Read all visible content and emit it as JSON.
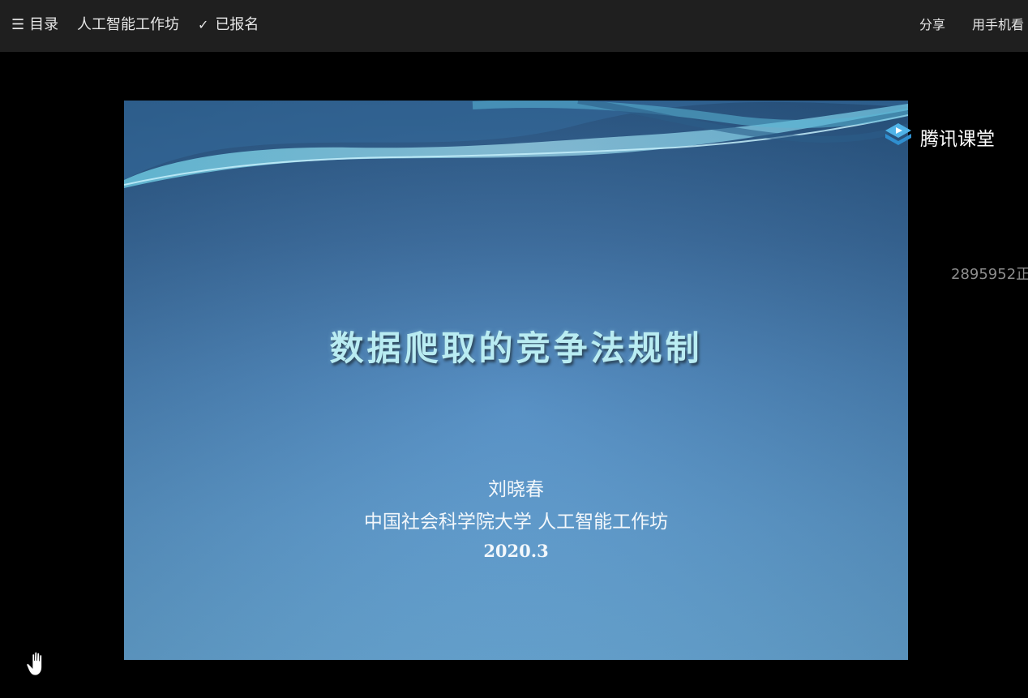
{
  "topbar": {
    "menu_icon_glyph": "☰",
    "menu_label": "目录",
    "course_title": "人工智能工作坊",
    "check_glyph": "✓",
    "registered_label": "已报名",
    "share_label": "分享",
    "mobile_label": "用手机看"
  },
  "slide": {
    "title": "数据爬取的竞争法规制",
    "author": "刘晓春",
    "affiliation": "中国社会科学院大学  人工智能工作坊",
    "date": "2020.3"
  },
  "brand": {
    "name": "腾讯课堂",
    "logo_icon": "tencent-classroom-logo-icon"
  },
  "stream": {
    "viewer_count_text": "2895952正"
  },
  "controls": {
    "raise_hand_icon": "raise-hand-icon"
  },
  "colors": {
    "topbar_bg": "#1f1f1f",
    "stage_bg": "#000000",
    "slide_title": "#b9ecf2",
    "slide_text": "#f2f7fb",
    "viewer_count": "#8c8c8c"
  }
}
